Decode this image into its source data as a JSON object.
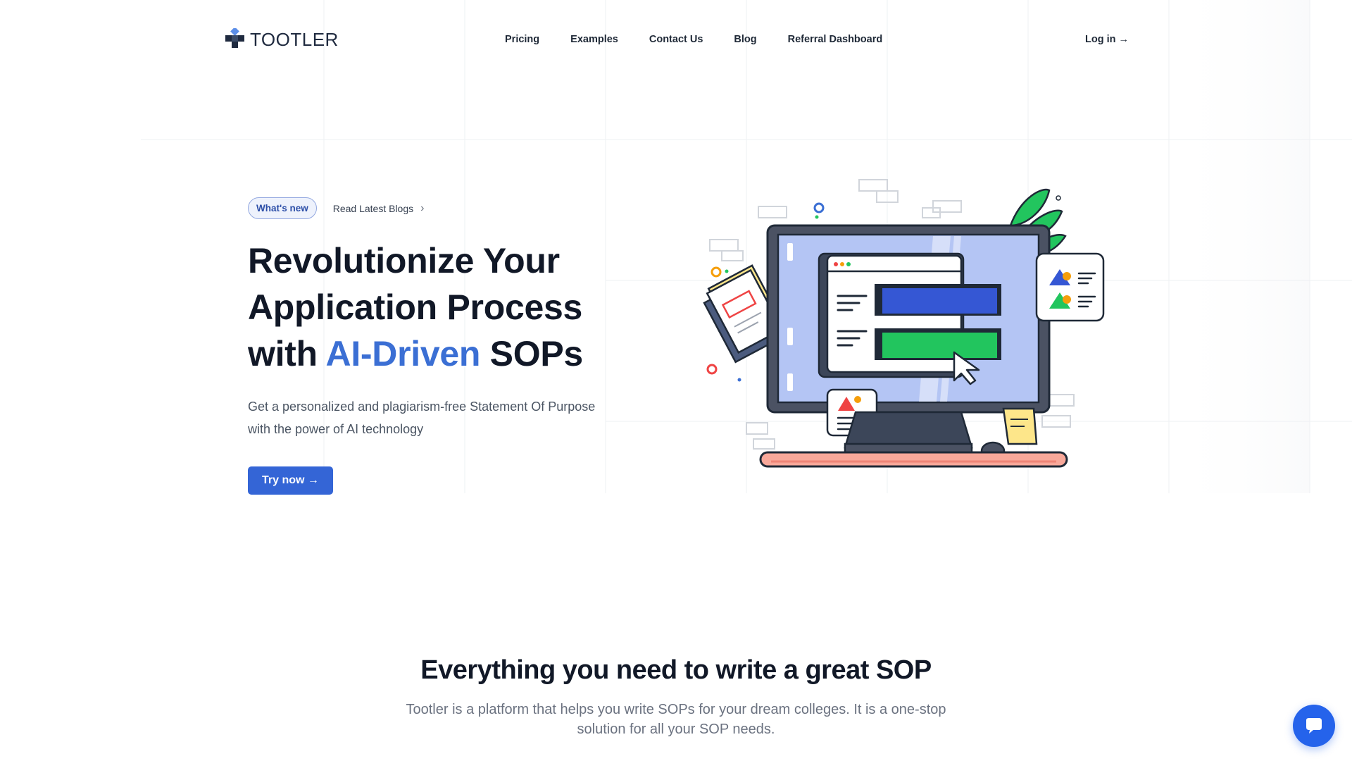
{
  "header": {
    "logo_text": "TOOTLER",
    "nav": [
      "Pricing",
      "Examples",
      "Contact Us",
      "Blog",
      "Referral Dashboard"
    ],
    "login_label": "Log in →"
  },
  "hero": {
    "badge": "What's new",
    "badge_link": "Read Latest Blogs",
    "title_line1": "Revolutionize Your",
    "title_line2": "Application Process",
    "title_line3_pre": "with ",
    "title_line3_accent": "AI-Driven",
    "title_line3_post": " SOPs",
    "subtitle": "Get a personalized and plagiarism-free Statement Of Purpose with the power of AI technology",
    "cta_label": "Try now →"
  },
  "features": {
    "heading": "Everything you need to write a great SOP",
    "description": "Tootler is a platform that helps you write SOPs for your dream colleges. It is a one-stop solution for all your SOP needs."
  },
  "colors": {
    "accent": "#3b6fd4",
    "button": "#3465d6",
    "chat": "#2563eb"
  }
}
